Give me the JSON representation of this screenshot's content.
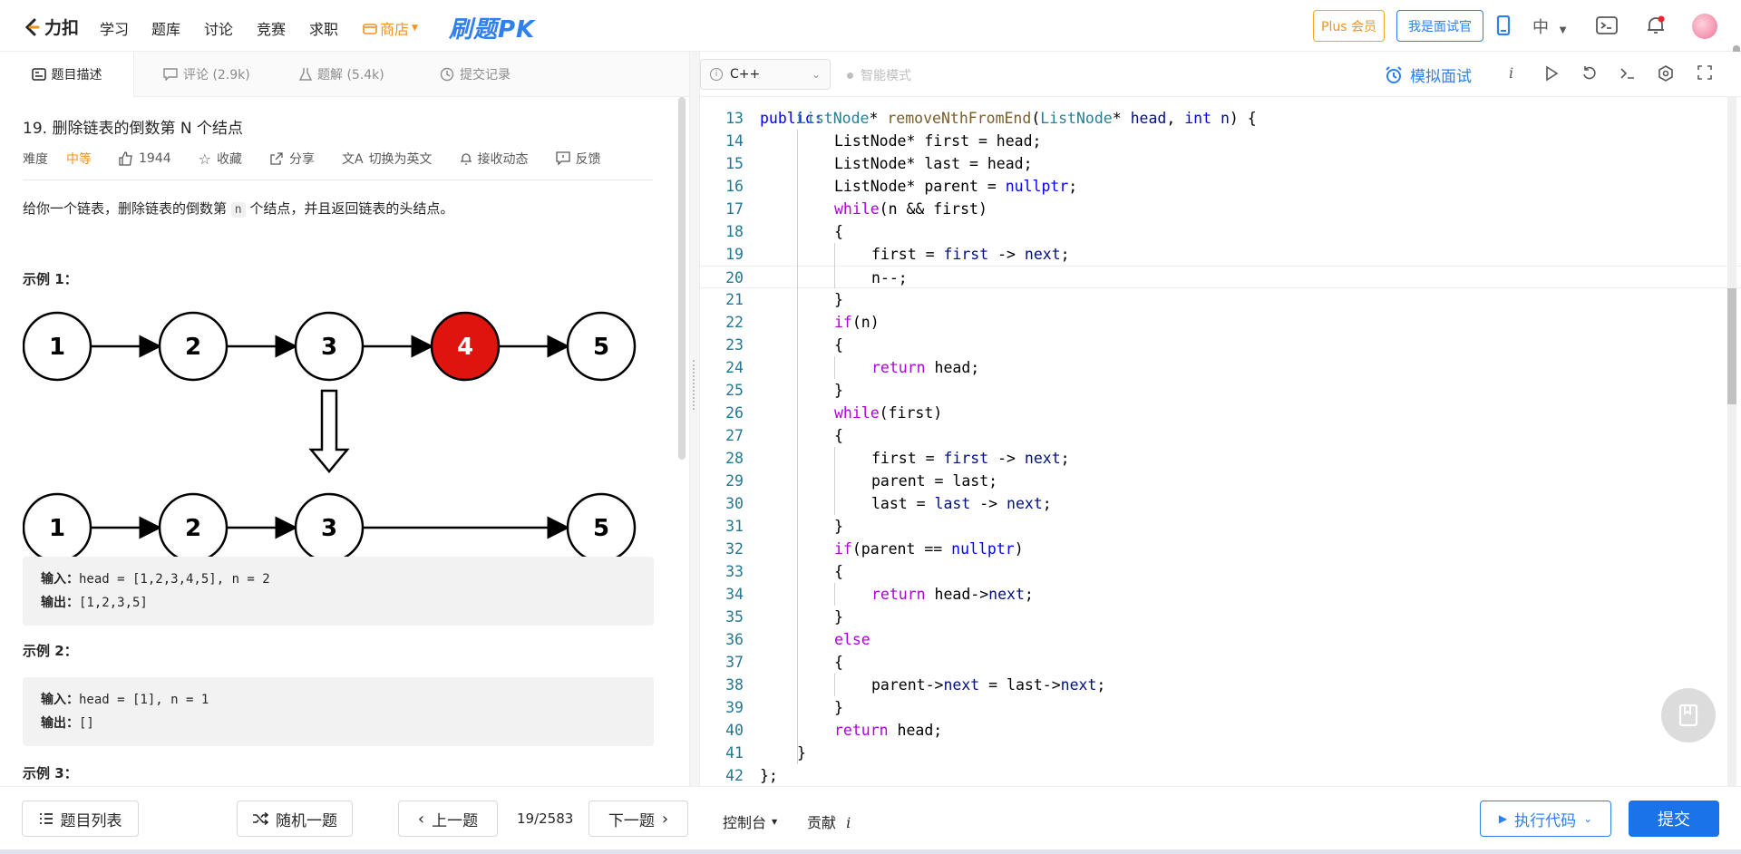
{
  "topnav": {
    "logo": "力扣",
    "items": [
      "学习",
      "题库",
      "讨论",
      "竞赛",
      "求职"
    ],
    "shop": "商店",
    "pk_logo": "刷题PK",
    "plus": "Plus 会员",
    "interviewer": "我是面试官",
    "lang": "中"
  },
  "left_tabs": [
    {
      "label": "题目描述"
    },
    {
      "label": "评论 (2.9k)"
    },
    {
      "label": "题解 (5.4k)"
    },
    {
      "label": "提交记录"
    }
  ],
  "problem": {
    "title": "19. 删除链表的倒数第 N 个结点",
    "difficulty_label": "难度",
    "difficulty": "中等",
    "likes": "1944",
    "favorite": "收藏",
    "share": "分享",
    "switch_lang": "切换为英文",
    "subscribe": "接收动态",
    "feedback": "反馈",
    "desc_before": "给你一个链表，删除链表的倒数第 ",
    "desc_code": "n",
    "desc_after": " 个结点，并且返回链表的头结点。"
  },
  "diagram": {
    "top_nodes": [
      "1",
      "2",
      "3",
      "4",
      "5"
    ],
    "bottom_nodes": [
      "1",
      "2",
      "3",
      "5"
    ],
    "highlight_color": "#e0140f"
  },
  "examples": [
    {
      "title": "示例 1：",
      "input_label": "输入：",
      "input": "head = [1,2,3,4,5], n = 2",
      "output_label": "输出：",
      "output": "[1,2,3,5]"
    },
    {
      "title": "示例 2：",
      "input_label": "输入：",
      "input": "head = [1], n = 1",
      "output_label": "输出：",
      "output": "[]"
    },
    {
      "title": "示例 3："
    }
  ],
  "editor": {
    "language": "C++",
    "smart_mode": "智能模式",
    "mock_interview": "模拟面试",
    "info_icon": "i"
  },
  "code": {
    "partial_top": "public:",
    "lines": [
      {
        "n": "13",
        "indent": 1,
        "html": "<span class=\"ty\">ListNode</span>* <span class=\"fn\">removeNthFromEnd</span>(<span class=\"ty\">ListNode</span>* <span class=\"v\">head</span>, <span class=\"nl\">int</span> <span class=\"v\">n</span>) {"
      },
      {
        "n": "14",
        "indent": 2,
        "html": "ListNode* first = head;"
      },
      {
        "n": "15",
        "indent": 2,
        "html": "ListNode* last = head;"
      },
      {
        "n": "16",
        "indent": 2,
        "html": "ListNode* parent = <span class=\"nl\">nullptr</span>;"
      },
      {
        "n": "17",
        "indent": 2,
        "html": "<span class=\"kw\">while</span>(n &amp;&amp; first)"
      },
      {
        "n": "18",
        "indent": 2,
        "html": "{"
      },
      {
        "n": "19",
        "indent": 3,
        "html": "first = <span class=\"v\">first</span> -&gt; <span class=\"v\">next</span>;"
      },
      {
        "n": "20",
        "indent": 3,
        "html": "n--;"
      },
      {
        "n": "21",
        "indent": 2,
        "html": "}"
      },
      {
        "n": "22",
        "indent": 2,
        "html": "<span class=\"kw\">if</span>(n)"
      },
      {
        "n": "23",
        "indent": 2,
        "html": "{"
      },
      {
        "n": "24",
        "indent": 3,
        "html": "<span class=\"kw\">return</span> head;"
      },
      {
        "n": "25",
        "indent": 2,
        "html": "}"
      },
      {
        "n": "26",
        "indent": 2,
        "html": "<span class=\"kw\">while</span>(first)"
      },
      {
        "n": "27",
        "indent": 2,
        "html": "{"
      },
      {
        "n": "28",
        "indent": 3,
        "html": "first = <span class=\"v\">first</span> -&gt; <span class=\"v\">next</span>;"
      },
      {
        "n": "29",
        "indent": 3,
        "html": "parent = last;"
      },
      {
        "n": "30",
        "indent": 3,
        "html": "last = <span class=\"v\">last</span> -&gt; <span class=\"v\">next</span>;"
      },
      {
        "n": "31",
        "indent": 2,
        "html": "}"
      },
      {
        "n": "32",
        "indent": 2,
        "html": "<span class=\"kw\">if</span>(parent == <span class=\"nl\">nullptr</span>)"
      },
      {
        "n": "33",
        "indent": 2,
        "html": "{"
      },
      {
        "n": "34",
        "indent": 3,
        "html": "<span class=\"kw\">return</span> head-&gt;<span class=\"v\">next</span>;"
      },
      {
        "n": "35",
        "indent": 2,
        "html": "}"
      },
      {
        "n": "36",
        "indent": 2,
        "html": "<span class=\"kw\">else</span>"
      },
      {
        "n": "37",
        "indent": 2,
        "html": "{"
      },
      {
        "n": "38",
        "indent": 3,
        "html": "parent-&gt;<span class=\"v\">next</span> = last-&gt;<span class=\"v\">next</span>;"
      },
      {
        "n": "39",
        "indent": 2,
        "html": "}"
      },
      {
        "n": "40",
        "indent": 2,
        "html": "<span class=\"kw\">return</span> head;"
      },
      {
        "n": "41",
        "indent": 1,
        "html": "}"
      },
      {
        "n": "42",
        "indent": 0,
        "html": "};"
      }
    ]
  },
  "bottom": {
    "problem_list": "题目列表",
    "random": "随机一题",
    "prev": "上一题",
    "page": "19/2583",
    "next": "下一题",
    "console": "控制台",
    "contrib": "贡献",
    "run": "执行代码",
    "submit": "提交"
  }
}
